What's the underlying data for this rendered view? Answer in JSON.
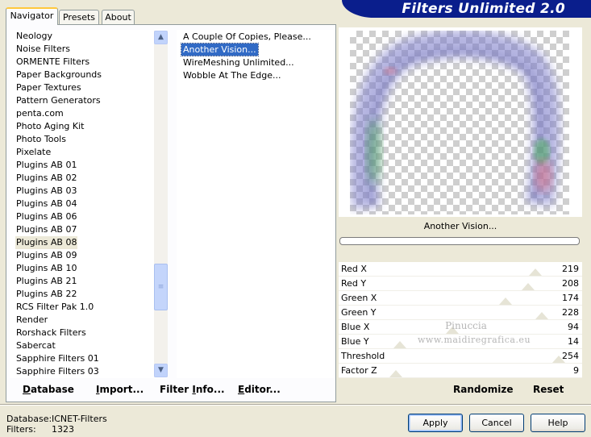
{
  "app": {
    "title": "Filters Unlimited 2.0"
  },
  "tabs": [
    {
      "label": "Navigator",
      "active": true
    },
    {
      "label": "Presets",
      "active": false
    },
    {
      "label": "About",
      "active": false
    }
  ],
  "categories": {
    "items": [
      "Neology",
      "Noise Filters",
      "ORMENTE Filters",
      "Paper Backgrounds",
      "Paper Textures",
      "Pattern Generators",
      "penta.com",
      "Photo Aging Kit",
      "Photo Tools",
      "Pixelate",
      "Plugins AB 01",
      "Plugins AB 02",
      "Plugins AB 03",
      "Plugins AB 04",
      "Plugins AB 06",
      "Plugins AB 07",
      "Plugins AB 08",
      "Plugins AB 09",
      "Plugins AB 10",
      "Plugins AB 21",
      "Plugins AB 22",
      "RCS Filter Pak 1.0",
      "Render",
      "Rorshack Filters",
      "Sabercat",
      "Sapphire Filters 01",
      "Sapphire Filters 03"
    ],
    "selected": "Plugins AB 08"
  },
  "filters": {
    "items": [
      "A Couple Of Copies, Please...",
      "Another Vision...",
      "WireMeshing Unlimited...",
      "Wobble At The Edge..."
    ],
    "selected": "Another Vision..."
  },
  "left_buttons": {
    "database": {
      "u": "D",
      "rest": "atabase"
    },
    "import": {
      "u": "I",
      "rest": "mport..."
    },
    "filter_info": {
      "pre": "Filter ",
      "u": "I",
      "rest": "nfo..."
    },
    "editor": {
      "u": "E",
      "rest": "ditor..."
    }
  },
  "preview": {
    "filter_name": "Another Vision...",
    "progress": 0
  },
  "sliders": [
    {
      "label": "Red X",
      "value": "219",
      "max": 255
    },
    {
      "label": "Red Y",
      "value": "208",
      "max": 255
    },
    {
      "label": "Green X",
      "value": "174",
      "max": 255
    },
    {
      "label": "Green Y",
      "value": "228",
      "max": 255
    },
    {
      "label": "Blue X",
      "value": "94",
      "max": 255
    },
    {
      "label": "Blue Y",
      "value": "14",
      "max": 255
    },
    {
      "label": "Threshold",
      "value": "254",
      "max": 255
    },
    {
      "label": "Factor Z",
      "value": "9",
      "max": 255
    }
  ],
  "watermark": {
    "line1": "Pinuccia",
    "line2": "www.maidiregrafica.eu"
  },
  "right_buttons": {
    "randomize": "Randomize",
    "reset": "Reset"
  },
  "status": {
    "database_label": "Database:",
    "database_value": "ICNET-Filters",
    "filters_label": "Filters:",
    "filters_value": "1323"
  },
  "dialog_buttons": {
    "apply": "Apply",
    "cancel": "Cancel",
    "help": "Help"
  },
  "colors": {
    "banner": "#0a1e8c",
    "selection": "#316ac5",
    "face": "#ece9d8"
  }
}
